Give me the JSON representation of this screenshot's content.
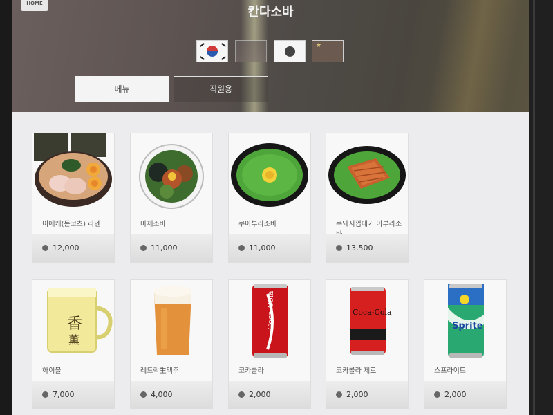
{
  "header": {
    "home_label": "HOME",
    "title": "칸다소바"
  },
  "languages": [
    {
      "code": "ko",
      "name": "Korean"
    },
    {
      "code": "en",
      "name": "English"
    },
    {
      "code": "ja",
      "name": "Japanese"
    },
    {
      "code": "zh",
      "name": "Chinese"
    }
  ],
  "tabs": [
    {
      "label": "메뉴",
      "active": true
    },
    {
      "label": "직원용",
      "active": false
    }
  ],
  "menu_items": [
    {
      "name": "이에케(돈코츠) 라멘",
      "price": "12,000",
      "icon": "tonkotsu-ramen"
    },
    {
      "name": "마제소바",
      "price": "11,000",
      "icon": "mazesoba"
    },
    {
      "name": "쿠아부라소바",
      "price": "11,000",
      "icon": "green-onion-soba"
    },
    {
      "name": "쿠돼지껍데기 아부라소바",
      "price": "13,500",
      "icon": "pork-skin-soba"
    },
    {
      "name": "하이볼",
      "price": "7,000",
      "icon": "highball-mug"
    },
    {
      "name": "레드락生맥주",
      "price": "4,000",
      "icon": "draft-beer"
    },
    {
      "name": "코카콜라",
      "price": "2,000",
      "icon": "coca-cola-can"
    },
    {
      "name": "코카콜라 제로",
      "price": "2,000",
      "icon": "coca-cola-zero-can"
    },
    {
      "name": "스프라이트",
      "price": "2,000",
      "icon": "sprite-can"
    }
  ],
  "colors": {
    "header_bg": "#5e5452",
    "card_bg": "#f8f8f8",
    "coke_red": "#c8141a",
    "sprite_green": "#2aa872"
  }
}
